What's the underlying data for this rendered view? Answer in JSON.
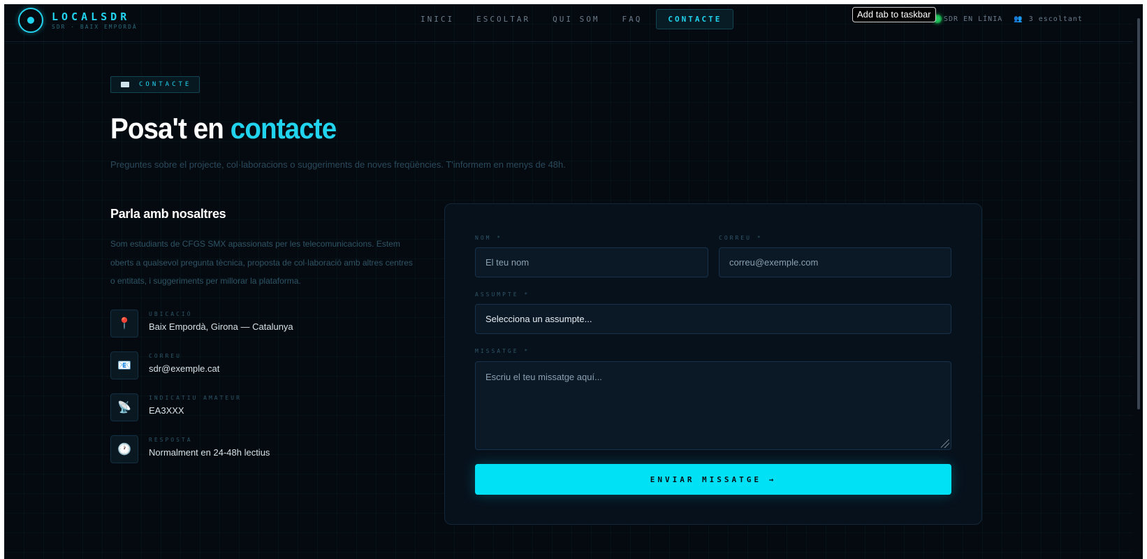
{
  "header": {
    "logo_title": "LOCALSDR",
    "logo_subtitle": "SDR · BAIX EMPORDÀ",
    "nav": [
      {
        "label": "INICI"
      },
      {
        "label": "ESCOLTAR"
      },
      {
        "label": "QUI SOM"
      },
      {
        "label": "FAQ"
      },
      {
        "label": "CONTACTE",
        "active": true
      }
    ],
    "status_text": "SDR EN LÍNIA",
    "listeners_text": "3 escoltant"
  },
  "tooltip": "Add tab to taskbar",
  "page": {
    "badge": "CONTACTE",
    "title_main": "Posa't en ",
    "title_accent": "contacte",
    "subtitle": "Preguntes sobre el projecte, col·laboracions o suggeriments de noves freqüències. T'informem en menys de 48h."
  },
  "left": {
    "heading": "Parla amb nosaltres",
    "description": "Som estudiants de CFGS SMX apassionats per les telecomunicacions. Estem oberts a qualsevol pregunta tècnica, proposta de col·laboració amb altres centres o entitats, i suggeriments per millorar la plataforma.",
    "items": [
      {
        "label": "UBICACIÓ",
        "value": "Baix Empordà, Girona — Catalunya",
        "icon": "location-pin-icon",
        "glyph": "📍"
      },
      {
        "label": "CORREU",
        "value": "sdr@exemple.cat",
        "icon": "email-icon",
        "glyph": "📧"
      },
      {
        "label": "INDICATIU AMATEUR",
        "value": "EA3XXX",
        "icon": "satellite-dish-icon",
        "glyph": "📡"
      },
      {
        "label": "RESPOSTA",
        "value": "Normalment en 24-48h lectius",
        "icon": "clock-icon",
        "glyph": "🕐"
      }
    ]
  },
  "form": {
    "name_label": "NOM *",
    "name_placeholder": "El teu nom",
    "email_label": "CORREU *",
    "email_placeholder": "correu@exemple.com",
    "subject_label": "ASSUMPTE *",
    "subject_value": "Selecciona un assumpte...",
    "message_label": "MISSATGE *",
    "message_placeholder": "Escriu el teu missatge aquí...",
    "submit_label": "ENVIAR MISSATGE →"
  },
  "colors": {
    "accent": "#22d3ee",
    "background": "#050a10",
    "button": "#00e1f5",
    "status_online": "#22c55e"
  }
}
